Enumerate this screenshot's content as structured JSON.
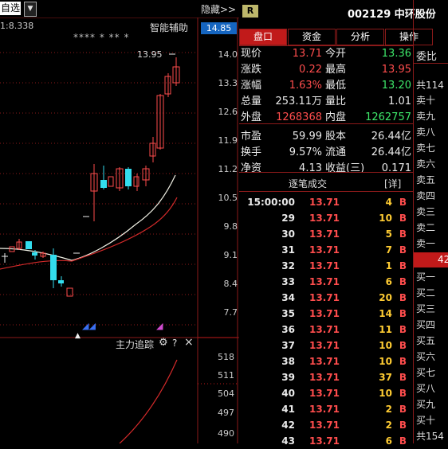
{
  "topbar": {
    "select_label": "自选",
    "hide_label": "隐藏>>",
    "scale_text": "1:8.338",
    "assist_label": "智能辅助",
    "stars": "**** * ** *",
    "high_label": "13.95"
  },
  "price_axis": {
    "current": "14.85",
    "ticks": [
      "14.0",
      "13.3",
      "12.6",
      "11.9",
      "11.2",
      "10.5",
      "9.8",
      "9.1",
      "8.4",
      "7.7"
    ]
  },
  "volume_panel": {
    "title": "主力追踪",
    "gear_icon": "gear-icon",
    "help": "?",
    "close": "×",
    "ticks": [
      "518",
      "511",
      "504",
      "497",
      "490"
    ]
  },
  "header": {
    "badge": "R",
    "code_name": "002129 中环股份"
  },
  "tabs": [
    "盘口",
    "资金",
    "分析",
    "操作"
  ],
  "quote": {
    "rows": [
      {
        "l1": "现价",
        "v1": "13.71",
        "c1": "red",
        "l2": "今开",
        "v2": "13.36",
        "c2": "green"
      },
      {
        "l1": "涨跌",
        "v1": "0.22",
        "c1": "red",
        "l2": "最高",
        "v2": "13.95",
        "c2": "red"
      },
      {
        "l1": "涨幅",
        "v1": "1.63%",
        "c1": "red",
        "l2": "最低",
        "v2": "13.20",
        "c2": "green"
      },
      {
        "l1": "总量",
        "v1": "253.11万",
        "c1": "white",
        "l2": "量比",
        "v2": "1.01",
        "c2": "white"
      },
      {
        "l1": "外盘",
        "v1": "1268368",
        "c1": "red",
        "l2": "内盘",
        "v2": "1262757",
        "c2": "green"
      },
      {
        "l1": "市盈",
        "v1": "59.99",
        "c1": "white",
        "l2": "股本",
        "v2": "26.44亿",
        "c2": "white"
      },
      {
        "l1": "换手",
        "v1": "9.57%",
        "c1": "white",
        "l2": "流通",
        "v2": "26.44亿",
        "c2": "white"
      },
      {
        "l1": "净资",
        "v1": "4.13",
        "c1": "white",
        "l2": "收益(三)",
        "v2": "0.171",
        "c2": "white"
      }
    ]
  },
  "trades": {
    "title": "逐笔成交",
    "detail": "[详]",
    "rows": [
      {
        "t": "15:00:00",
        "p": "13.71",
        "v": "4",
        "s": "B"
      },
      {
        "t": "29",
        "p": "13.71",
        "v": "10",
        "s": "B"
      },
      {
        "t": "30",
        "p": "13.71",
        "v": "5",
        "s": "B"
      },
      {
        "t": "31",
        "p": "13.71",
        "v": "7",
        "s": "B"
      },
      {
        "t": "32",
        "p": "13.71",
        "v": "1",
        "s": "B"
      },
      {
        "t": "33",
        "p": "13.71",
        "v": "6",
        "s": "B"
      },
      {
        "t": "34",
        "p": "13.71",
        "v": "20",
        "s": "B"
      },
      {
        "t": "35",
        "p": "13.71",
        "v": "14",
        "s": "B"
      },
      {
        "t": "36",
        "p": "13.71",
        "v": "11",
        "s": "B"
      },
      {
        "t": "37",
        "p": "13.71",
        "v": "10",
        "s": "B"
      },
      {
        "t": "38",
        "p": "13.71",
        "v": "10",
        "s": "B"
      },
      {
        "t": "39",
        "p": "13.71",
        "v": "37",
        "s": "B"
      },
      {
        "t": "40",
        "p": "13.71",
        "v": "10",
        "s": "B"
      },
      {
        "t": "41",
        "p": "13.71",
        "v": "2",
        "s": "B"
      },
      {
        "t": "42",
        "p": "13.71",
        "v": "2",
        "s": "B"
      },
      {
        "t": "43",
        "p": "13.71",
        "v": "6",
        "s": "B"
      }
    ]
  },
  "side": {
    "weibi": "委比",
    "sell_total": "共114",
    "sells": [
      "卖十",
      "卖九",
      "卖八",
      "卖七",
      "卖六",
      "卖五",
      "卖四",
      "卖三",
      "卖二",
      "卖一"
    ],
    "highlight": "42",
    "buys": [
      "买一",
      "买二",
      "买三",
      "买四",
      "买五",
      "买六",
      "买七",
      "买八",
      "买九",
      "买十"
    ],
    "buy_total": "共154"
  },
  "colors": {
    "up": "#ff4d4d",
    "down": "#3ee86a",
    "accent": "#c11a1a"
  }
}
